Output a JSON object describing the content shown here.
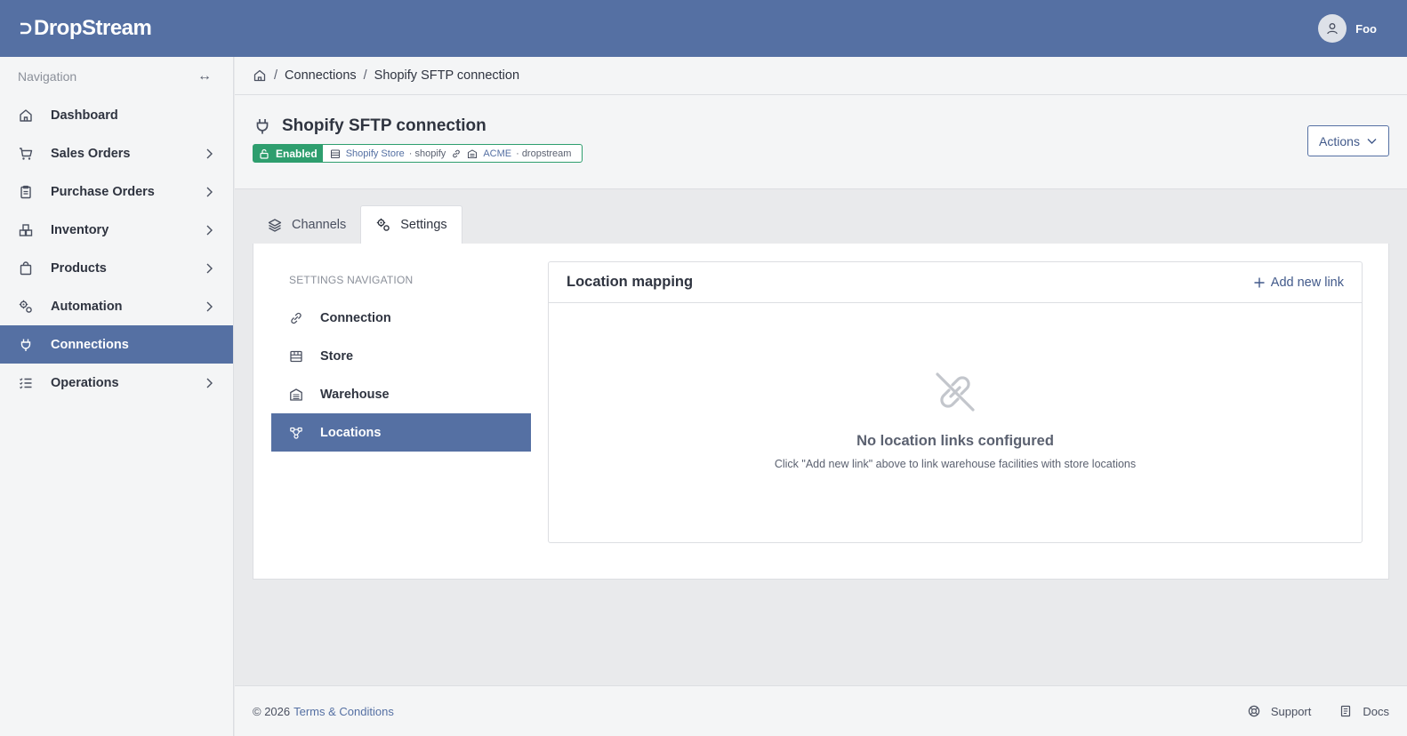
{
  "app": {
    "brand": "DropStream",
    "user_name": "Foo"
  },
  "sidebar": {
    "heading": "Navigation",
    "toggle_glyph": "↔",
    "items": [
      {
        "label": "Dashboard",
        "icon": "home-icon",
        "has_children": false
      },
      {
        "label": "Sales Orders",
        "icon": "cart-icon",
        "has_children": true
      },
      {
        "label": "Purchase Orders",
        "icon": "clipboard-icon",
        "has_children": true
      },
      {
        "label": "Inventory",
        "icon": "boxes-icon",
        "has_children": true
      },
      {
        "label": "Products",
        "icon": "bag-icon",
        "has_children": true
      },
      {
        "label": "Automation",
        "icon": "gears-icon",
        "has_children": true
      },
      {
        "label": "Connections",
        "icon": "plug-icon",
        "has_children": false,
        "active": true
      },
      {
        "label": "Operations",
        "icon": "list-icon",
        "has_children": true
      }
    ]
  },
  "breadcrumb": {
    "separator": "/",
    "items": [
      "Connections",
      "Shopify SFTP connection"
    ]
  },
  "page": {
    "title": "Shopify SFTP connection",
    "status": "Enabled",
    "store_name": "Shopify Store",
    "store_type": "· shopify",
    "warehouse_name": "ACME",
    "warehouse_type": "· dropstream",
    "actions_label": "Actions"
  },
  "tabs": [
    {
      "label": "Channels",
      "icon": "layers-icon",
      "active": false
    },
    {
      "label": "Settings",
      "icon": "gears-icon",
      "active": true
    }
  ],
  "settings_nav": {
    "heading": "Settings navigation",
    "items": [
      {
        "label": "Connection",
        "icon": "link-icon"
      },
      {
        "label": "Store",
        "icon": "store-icon"
      },
      {
        "label": "Warehouse",
        "icon": "warehouse-icon"
      },
      {
        "label": "Locations",
        "icon": "network-icon",
        "active": true
      }
    ]
  },
  "location_mapping": {
    "title": "Location mapping",
    "add_label": "Add new link",
    "empty_title": "No location links configured",
    "empty_desc": "Click \"Add new link\" above to link warehouse facilities with store locations"
  },
  "footer": {
    "copyright": "© 2026",
    "terms": "Terms & Conditions",
    "support": "Support",
    "docs": "Docs"
  },
  "colors": {
    "primary": "#5570a3",
    "success": "#2e9e6e",
    "sidebar_bg": "#f4f5f6",
    "content_bg": "#e9eaec"
  }
}
